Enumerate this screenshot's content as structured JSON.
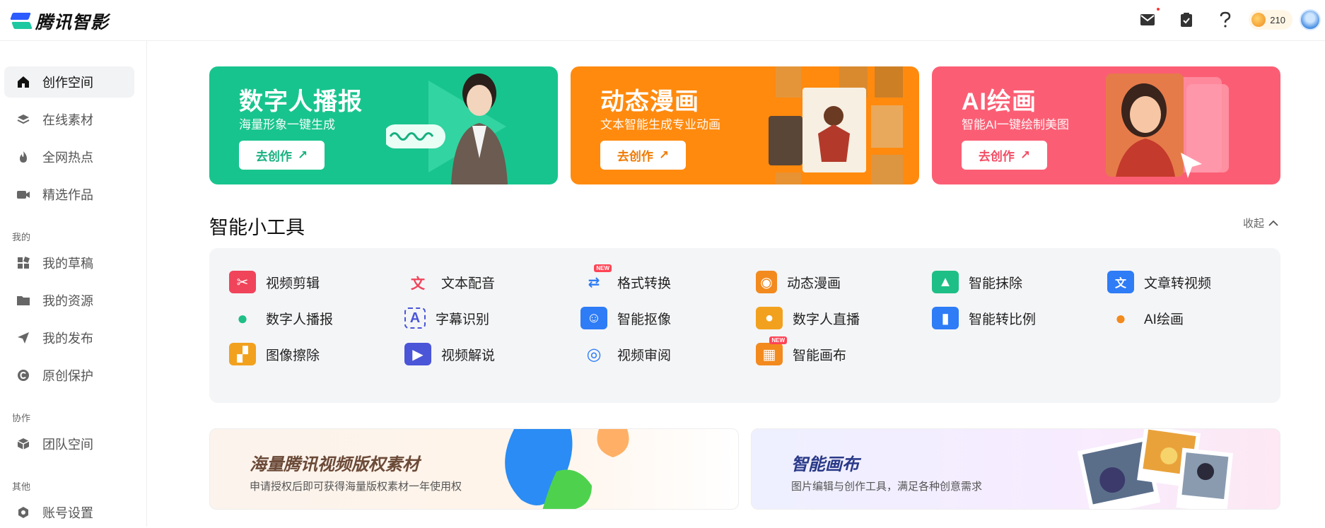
{
  "app": {
    "name": "腾讯智影"
  },
  "topbar": {
    "coins": "210"
  },
  "sidebar": {
    "items": [
      {
        "label": "创作空间",
        "icon": "home-icon",
        "active": true
      },
      {
        "label": "在线素材",
        "icon": "layers-icon"
      },
      {
        "label": "全网热点",
        "icon": "flame-icon"
      },
      {
        "label": "精选作品",
        "icon": "video-camera-icon"
      }
    ],
    "group_mine": "我的",
    "mine_items": [
      {
        "label": "我的草稿",
        "icon": "grid-icon"
      },
      {
        "label": "我的资源",
        "icon": "folder-icon"
      },
      {
        "label": "我的发布",
        "icon": "send-icon"
      },
      {
        "label": "原创保护",
        "icon": "copyright-icon"
      }
    ],
    "group_collab": "协作",
    "collab_items": [
      {
        "label": "团队空间",
        "icon": "cube-icon"
      }
    ],
    "group_other": "其他",
    "other_items": [
      {
        "label": "账号设置",
        "icon": "settings-hex-icon"
      }
    ]
  },
  "banners": [
    {
      "title": "数字人播报",
      "subtitle": "海量形象一键生成",
      "button": "去创作",
      "color": "#18c48d"
    },
    {
      "title": "动态漫画",
      "subtitle": "文本智能生成专业动画",
      "button": "去创作",
      "color": "#ff8a0e"
    },
    {
      "title": "AI绘画",
      "subtitle": "智能AI一键绘制美图",
      "button": "去创作",
      "color": "#fb5e74"
    }
  ],
  "tools": {
    "title": "智能小工具",
    "collapse_label": "收起",
    "new_badge": "NEW",
    "items": [
      {
        "label": "视频剪辑",
        "icon": "scissors-film-icon",
        "color": "#f0445a"
      },
      {
        "label": "文本配音",
        "icon": "text-voice-icon",
        "color": "#f0445a"
      },
      {
        "label": "格式转换",
        "icon": "format-convert-icon",
        "color": "#2e7cf6",
        "new": true
      },
      {
        "label": "动态漫画",
        "icon": "palette-card-icon",
        "color": "#f28a1e"
      },
      {
        "label": "智能抹除",
        "icon": "image-erase-icon",
        "color": "#1ebf86"
      },
      {
        "label": "文章转视频",
        "icon": "article-video-icon",
        "color": "#2e7cf6"
      },
      {
        "label": "数字人播报",
        "icon": "speaking-head-icon",
        "color": "#1ebf86"
      },
      {
        "label": "字幕识别",
        "icon": "subtitle-scan-icon",
        "color": "#4a55d8"
      },
      {
        "label": "智能抠像",
        "icon": "portrait-cutout-icon",
        "color": "#2e7cf6"
      },
      {
        "label": "数字人直播",
        "icon": "live-person-icon",
        "color": "#f2a11e"
      },
      {
        "label": "智能转比例",
        "icon": "aspect-ratio-icon",
        "color": "#2e7cf6"
      },
      {
        "label": "AI绘画",
        "icon": "paint-palette-icon",
        "color": "#f28a1e"
      },
      {
        "label": "图像擦除",
        "icon": "image-eraser-icon",
        "color": "#f2a11e"
      },
      {
        "label": "视频解说",
        "icon": "video-narration-icon",
        "color": "#4a55d8"
      },
      {
        "label": "视频审阅",
        "icon": "video-review-icon",
        "color": "#2e7cf6"
      },
      {
        "label": "智能画布",
        "icon": "smart-canvas-icon",
        "color": "#f28a1e",
        "new": true
      }
    ]
  },
  "promos": [
    {
      "title": "海量腾讯视频版权素材",
      "subtitle": "申请授权后即可获得海量版权素材一年使用权"
    },
    {
      "title": "智能画布",
      "subtitle": "图片编辑与创作工具，满足各种创意需求"
    }
  ]
}
